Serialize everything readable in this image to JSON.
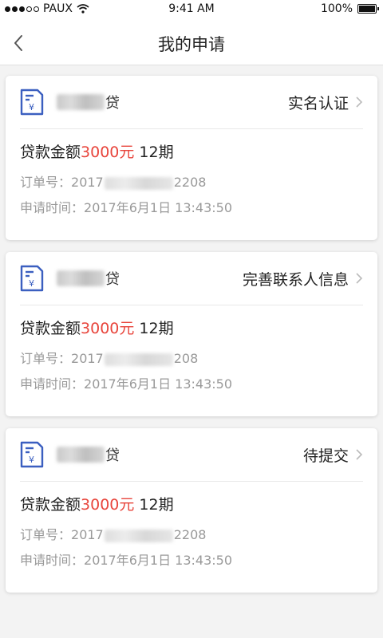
{
  "status_bar": {
    "carrier": "PAUX",
    "time": "9:41 AM",
    "battery": "100%"
  },
  "nav": {
    "title": "我的申请"
  },
  "cards": [
    {
      "lender_suffix": "贷",
      "status": "实名认证",
      "amount_label": "贷款金额",
      "amount_value": "3000元",
      "term": "12期",
      "order_label": "订单号：",
      "order_prefix": "2017",
      "order_suffix": "2208",
      "time_label": "申请时间：",
      "time_value": "2017年6月1日 13:43:50"
    },
    {
      "lender_suffix": "贷",
      "status": "完善联系人信息",
      "amount_label": "贷款金额",
      "amount_value": "3000元",
      "term": "12期",
      "order_label": "订单号：",
      "order_prefix": "2017",
      "order_suffix": "208",
      "time_label": "申请时间：",
      "time_value": "2017年6月1日 13:43:50"
    },
    {
      "lender_suffix": "贷",
      "status": "待提交",
      "amount_label": "贷款金额",
      "amount_value": "3000元",
      "term": "12期",
      "order_label": "订单号：",
      "order_prefix": "2017",
      "order_suffix": "2208",
      "time_label": "申请时间：",
      "time_value": "2017年6月1日 13:43:50"
    }
  ],
  "colors": {
    "accent_red": "#e8453c",
    "icon_blue": "#3b5fc0"
  },
  "icons": {
    "back": "chevron-left-icon",
    "doc": "loan-document-icon",
    "chevron": "chevron-right-icon",
    "wifi": "wifi-icon",
    "battery": "battery-icon"
  }
}
